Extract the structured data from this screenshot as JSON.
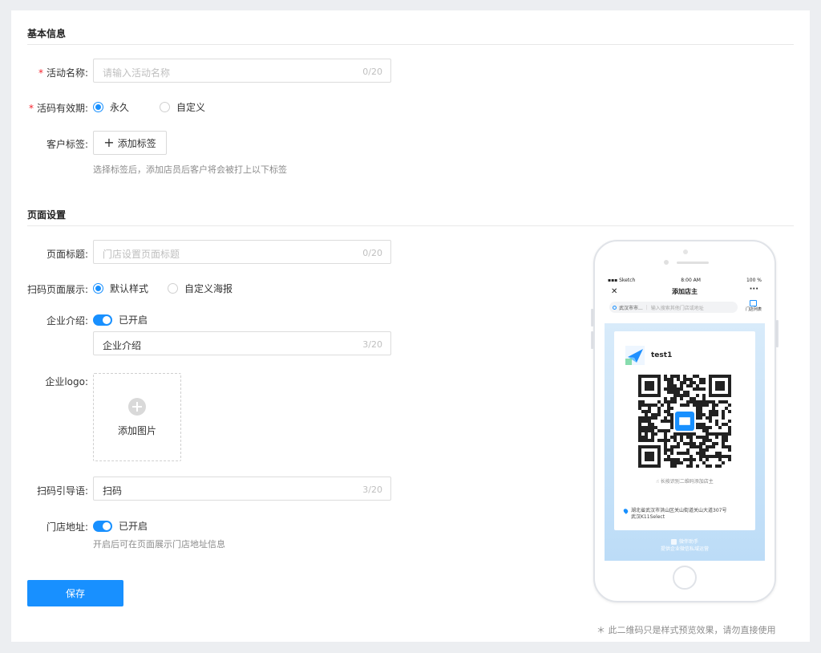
{
  "sections": {
    "basic_title": "基本信息",
    "page_title": "页面设置"
  },
  "activity_name": {
    "label": "活动名称:",
    "placeholder": "请输入活动名称",
    "counter": "0/20"
  },
  "validity": {
    "label": "活码有效期:",
    "options": [
      "永久",
      "自定义"
    ],
    "selected": "永久"
  },
  "customer_tag": {
    "label": "客户标签:",
    "button": "添加标签",
    "hint": "选择标签后，添加店员后客户将会被打上以下标签"
  },
  "page_heading": {
    "label": "页面标题:",
    "placeholder": "门店设置页面标题",
    "counter": "0/20"
  },
  "scan_display": {
    "label": "扫码页面展示:",
    "options": [
      "默认样式",
      "自定义海报"
    ],
    "selected": "默认样式"
  },
  "company_intro": {
    "label": "企业介绍:",
    "switch_text": "已开启",
    "enabled": true,
    "value": "企业介绍",
    "counter": "3/20"
  },
  "company_logo": {
    "label": "企业logo:",
    "upload_text": "添加图片"
  },
  "scan_guide": {
    "label": "扫码引导语:",
    "value": "扫码",
    "counter": "3/20"
  },
  "store_address": {
    "label": "门店地址:",
    "switch_text": "已开启",
    "enabled": true,
    "hint": "开启后可在页面展示门店地址信息"
  },
  "save_label": "保存",
  "preview": {
    "status_left": "Sketch",
    "status_time": "8:00 AM",
    "status_right": "100 %",
    "nav_title": "添加店主",
    "search_city": "武汉市市...",
    "search_placeholder": "输入搜索其他门店或地址",
    "store_list": "门店列表",
    "shop_name": "test1",
    "longpress_text": "长按识别二维码添加店主",
    "address_line1": "湖北省武汉市洪山区关山街道关山大道307号",
    "address_line2": "武汉K11Select",
    "brand_name": "微伴助手",
    "brand_sub": "提供企业微信私域运营",
    "note": "＊ 此二维码只是样式预览效果，请勿直接使用"
  },
  "colors": {
    "primary": "#1890ff",
    "required": "#f5222d",
    "background": "#eceef1"
  }
}
